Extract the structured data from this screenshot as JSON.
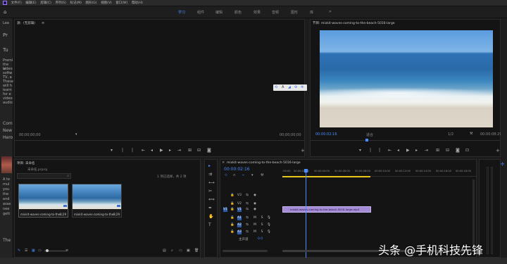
{
  "menu": [
    "文件(F)",
    "编辑(E)",
    "剪辑(C)",
    "序列(S)",
    "标记(M)",
    "图形(G)",
    "视图(V)",
    "窗口(W)",
    "帮助(H)"
  ],
  "workspaces": [
    {
      "label": "学习",
      "active": true
    },
    {
      "label": "组件",
      "active": false
    },
    {
      "label": "编辑",
      "active": false
    },
    {
      "label": "颜色",
      "active": false
    },
    {
      "label": "效果",
      "active": false
    },
    {
      "label": "音频",
      "active": false
    },
    {
      "label": "图形",
      "active": false
    },
    {
      "label": "库",
      "active": false
    }
  ],
  "sidebar": {
    "lines": [
      "Lea",
      "Pr",
      "Tu",
      "Premi",
      "the le",
      "video",
      "softw",
      "TV, a",
      "These",
      "will h",
      "learn",
      "for e",
      "video",
      "audio",
      "Com",
      "New",
      "Hero",
      "A te",
      "mul",
      "you",
      "the",
      "end",
      "asse",
      "nee",
      "gett",
      "The"
    ]
  },
  "source_monitor": {
    "title": "源：(无剪辑)",
    "tc_left": "00;00;00;00",
    "tc_right": "00;00;00;00"
  },
  "program_monitor": {
    "title": "节目: mixkit-waves-coming-to-the-beach-5016-large",
    "tc_current": "00:00:02:16",
    "fit": "适合",
    "scale": "1/2",
    "tc_total": "00:00:08:29"
  },
  "project": {
    "title": "项目: 未命名",
    "subtitle": "未命名.prproj",
    "selection": "1 项已选择，共 2 项",
    "items": [
      {
        "label": "mixkit-waves-coming-to-the...",
        "duration": "8:29"
      },
      {
        "label": "mixkit-waves-coming-to-the...",
        "duration": "8:29"
      }
    ]
  },
  "timeline": {
    "tab": "mixkit-waves-coming-to-the-beach-5016-large",
    "tc": "00:00:02:16",
    "ruler": [
      ":00:00",
      "00:00:02:00",
      "00:00:04:00",
      "00:00:06:00",
      "00:00:08:00",
      "00:00:10:00",
      "00:00:12:00",
      "00:00:14:00",
      "00:00:16:00",
      "00:00:18:00"
    ],
    "tracks": [
      "V3",
      "V2",
      "V1",
      "A1",
      "A2",
      "A3"
    ],
    "master_label": "主声道",
    "master_value": "0.0",
    "clip_label": "mixkit-waves-coming-to-the-beach-5016-large.mp4"
  },
  "effects_bar": [
    "A"
  ],
  "watermark": "头条 @手机科技先锋",
  "colors": {
    "accent": "#4a8cff",
    "clip": "#a58bd6",
    "timebar": "#e8c61a"
  }
}
